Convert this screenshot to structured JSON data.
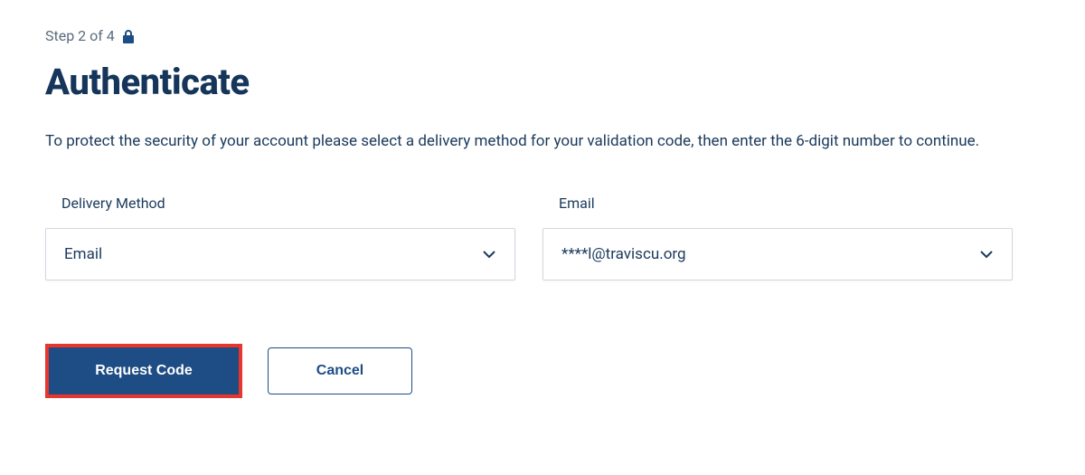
{
  "step": {
    "label": "Step 2 of 4"
  },
  "title": "Authenticate",
  "instructions": "To protect the security of your account please select a delivery method for your validation code, then enter the 6-digit number to continue.",
  "form": {
    "delivery_method": {
      "label": "Delivery Method",
      "value": "Email"
    },
    "email": {
      "label": "Email",
      "value": "****l@traviscu.org"
    }
  },
  "buttons": {
    "request_code": "Request Code",
    "cancel": "Cancel"
  },
  "colors": {
    "primary": "#1d4d84",
    "highlight": "#e8352d",
    "text": "#1a3a5c",
    "muted": "#5a6c7d"
  }
}
